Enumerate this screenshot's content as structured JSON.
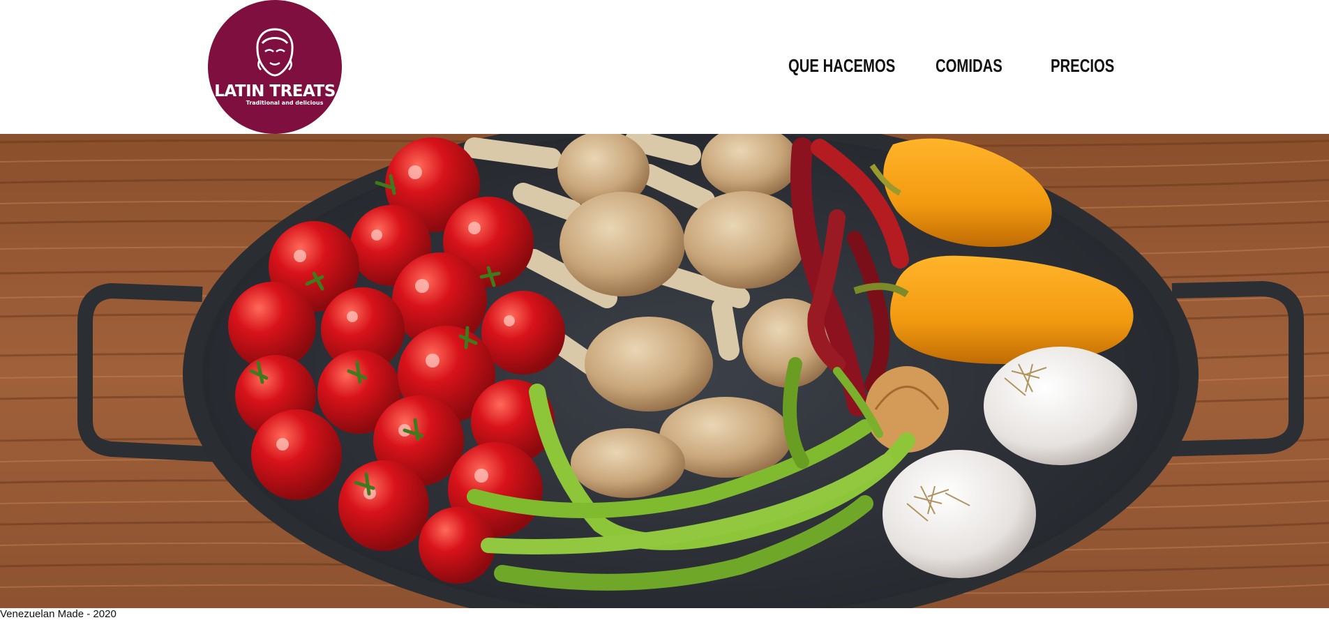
{
  "brand": {
    "logo_text": "LATIN TREATS",
    "tagline": "Traditional and delicious",
    "logo_color": "#7e0f3f"
  },
  "nav": {
    "items": [
      {
        "label": "QUE HACEMOS"
      },
      {
        "label": "COMIDAS"
      },
      {
        "label": "PRECIOS"
      }
    ]
  },
  "hero": {
    "image": "vegetables-in-pan-on-wood-table",
    "items": [
      "cherry-tomatoes",
      "mushrooms",
      "chili-peppers",
      "yellow-bell-peppers",
      "green-peppers",
      "garlic",
      "onion"
    ]
  },
  "footer": {
    "text": "Venezuelan Made - 2020"
  }
}
